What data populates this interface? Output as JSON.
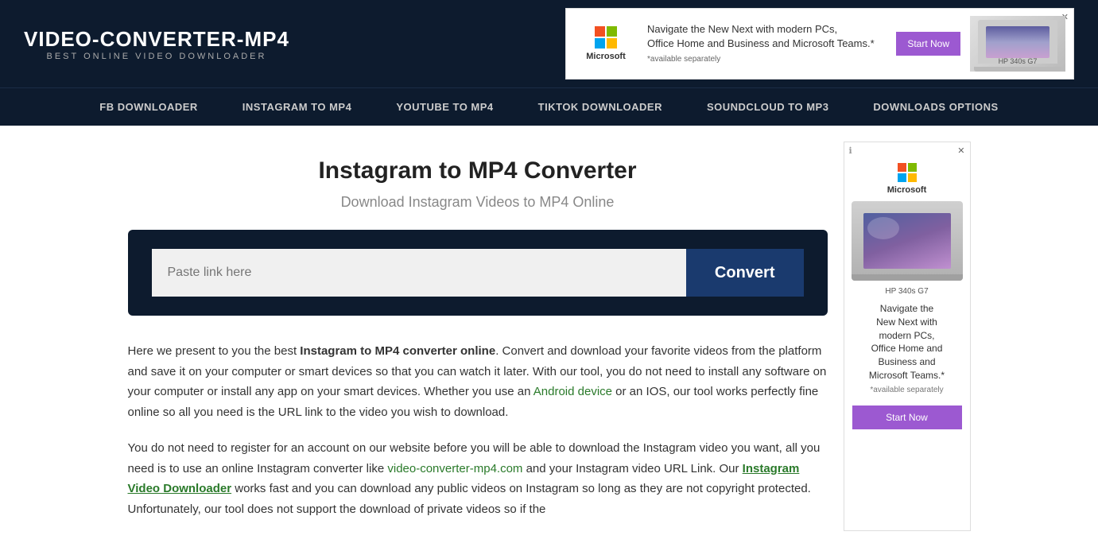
{
  "header": {
    "logo_title": "VIDEO-CONVERTER-MP4",
    "logo_subtitle": "BEST ONLINE VIDEO DOWNLOADER",
    "ad": {
      "close_label": "✕",
      "info_label": "ℹ",
      "ms_label": "Microsoft",
      "text_line1": "Navigate the New Next with modern PCs,",
      "text_line2": "Office Home and Business and Microsoft Teams.*",
      "text_note": "*available separately",
      "btn_label": "Start Now",
      "laptop_label": "HP 340s G7"
    }
  },
  "nav": {
    "items": [
      {
        "label": "FB DOWNLOADER"
      },
      {
        "label": "INSTAGRAM TO MP4"
      },
      {
        "label": "YOUTUBE TO MP4"
      },
      {
        "label": "TIKTOK DOWNLOADER"
      },
      {
        "label": "SOUNDCLOUD TO MP3"
      },
      {
        "label": "DOWNLOADS OPTIONS"
      }
    ]
  },
  "main": {
    "page_title": "Instagram to MP4 Converter",
    "page_subtitle": "Download Instagram Videos to MP4 Online",
    "input_placeholder": "Paste link here",
    "convert_btn": "Convert",
    "body_paragraphs": [
      {
        "prefix": "Here we present to you the best ",
        "bold": "Instagram to MP4 converter online",
        "suffix": ". Convert and download your favorite videos from the platform and save it on your computer or smart devices so that you can watch it later. With our tool, you do not need to install any software on your computer or install any app on your smart devices. Whether you use an ",
        "link1_text": "Android device",
        "middle": " or an IOS, our tool works perfectly fine online so all you need is the URL link to the video you wish to download."
      },
      {
        "prefix": "You do not need to register for an account on our website before you will be able to download the Instagram video you want, all you need is to use an online Instagram converter like ",
        "link2_text": "video-converter-mp4.com",
        "middle": " and your Instagram video URL Link. Our ",
        "link3_text": "Instagram Video Downloader",
        "suffix": " works fast and you can download any public videos on Instagram so long as they are not copyright protected. Unfortunately, our tool does not support the download of private videos so if the"
      }
    ]
  },
  "sidebar": {
    "ad": {
      "close_label": "✕",
      "info_label": "ℹ",
      "ms_label": "Microsoft",
      "laptop_label": "HP 340s G7",
      "text_line1": "Navigate the",
      "text_line2": "New Next with",
      "text_line3": "modern PCs,",
      "text_line4": "Office Home and",
      "text_line5": "Business and",
      "text_line6": "Microsoft Teams.*",
      "text_note": "*available separately",
      "btn_label": "Start Now"
    }
  }
}
